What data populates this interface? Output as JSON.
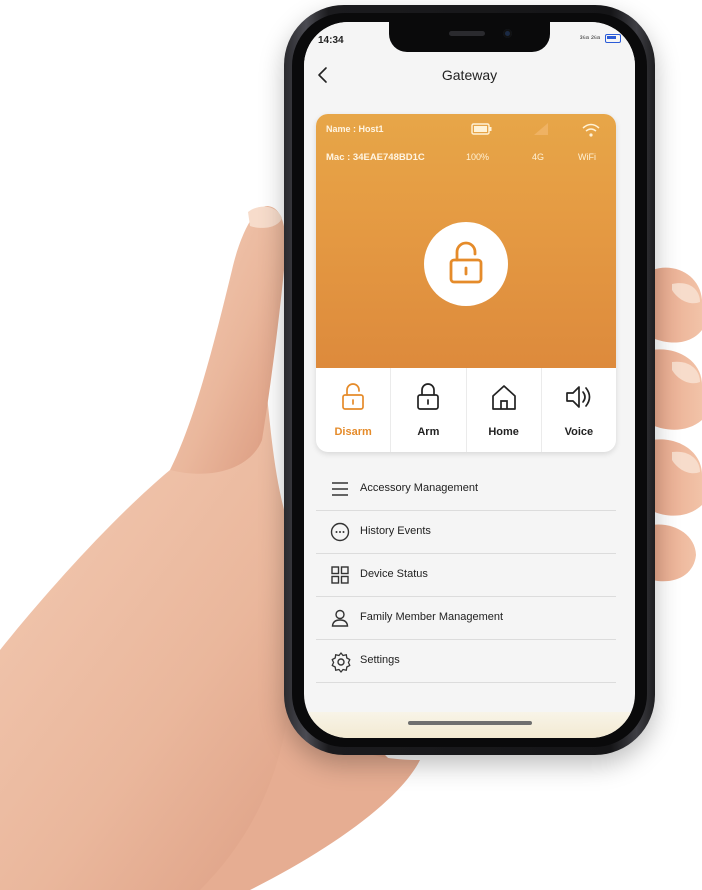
{
  "status_bar": {
    "time": "14:34",
    "network_text": "³⁶ᵃ ²⁶ᵃ"
  },
  "header": {
    "title": "Gateway",
    "back_icon": "chevron-left-icon"
  },
  "card": {
    "name": "Name : Host1",
    "mac": "Mac : 34EAE748BD1C",
    "battery_value": "100%",
    "signal_value": "4G",
    "wifi_value": "WiFi",
    "lock_state_icon": "unlocked-padlock-icon",
    "accent_color": "#e59b43"
  },
  "modes": [
    {
      "label": "Disarm",
      "icon": "unlocked-padlock-icon",
      "active": true
    },
    {
      "label": "Arm",
      "icon": "locked-padlock-icon",
      "active": false
    },
    {
      "label": "Home",
      "icon": "house-icon",
      "active": false
    },
    {
      "label": "Voice",
      "icon": "speaker-icon",
      "active": false
    }
  ],
  "menu": [
    {
      "label": "Accessory Management",
      "icon": "hamburger-list-icon"
    },
    {
      "label": "History Events",
      "icon": "ellipsis-circle-icon"
    },
    {
      "label": "Device Status",
      "icon": "grid-icon"
    },
    {
      "label": "Family Member Management",
      "icon": "person-icon"
    },
    {
      "label": "Settings",
      "icon": "gear-icon"
    }
  ]
}
